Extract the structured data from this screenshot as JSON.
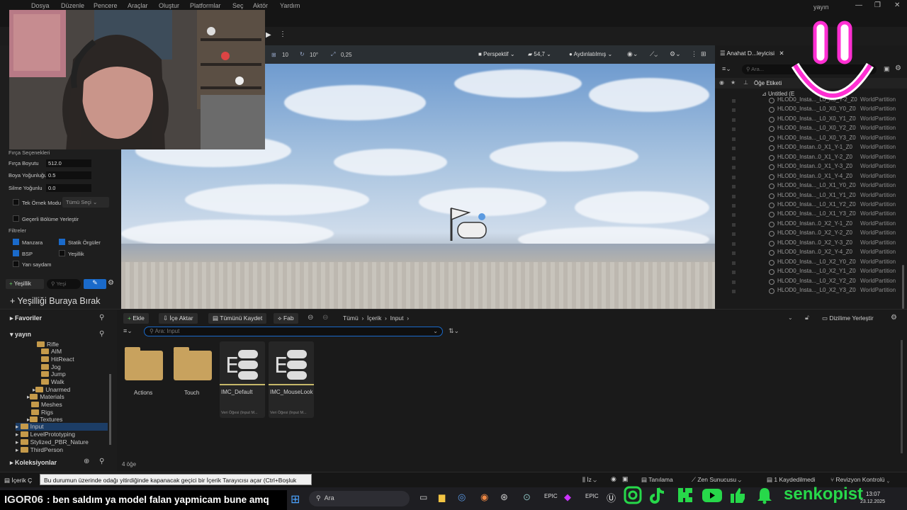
{
  "menu": {
    "items": [
      "Dosya",
      "Düzenle",
      "Pencere",
      "Araçlar",
      "Oluştur",
      "Platformlar",
      "Seç",
      "Aktör",
      "Yardım"
    ],
    "window_title": "yayın"
  },
  "viewport_toolbar": {
    "grid_snap": "10",
    "rot_snap": "10°",
    "scale_snap": "0,25",
    "perspective": "Perspektif",
    "fov": "54,7",
    "lit": "Aydınlatılmış"
  },
  "left_panel": {
    "brush_options_title": "Fırça Seçenekleri",
    "brush_size_label": "Fırça Boyutu",
    "brush_size_value": "512.0",
    "paint_density_label": "Boya Yoğunluğu",
    "paint_density_value": "0.5",
    "erase_density_label": "Silme Yoğunlu",
    "erase_density_value": "0.0",
    "single_sample_label": "Tek Örnek Modu",
    "select_all_label": "Tümü Seçi",
    "place_valid_label": "Geçerli Bölüme Yerleştir",
    "filters_title": "Filtreler",
    "filter_landscape": "Manzara",
    "filter_static_mesh": "Statik Örgüler",
    "filter_bsp": "BSP",
    "filter_foliage": "Yeşillik",
    "filter_translucent": "Yarı saydam",
    "foliage_button": "Yeşillik",
    "search_placeholder": "Yeşi",
    "drop_foliage_text": "+ Yeşilliği Buraya Bırak"
  },
  "outliner": {
    "tab_title": "Anahat D...leyicisi",
    "search_placeholder": "Ara...",
    "column_label": "Öğe Etiketi",
    "root": "Untitled (E",
    "rows": [
      {
        "name": "HLOD0_Insta..._L0_X0_Y-2_Z0",
        "type": "WorldPartition"
      },
      {
        "name": "HLOD0_Insta..._L0_X0_Y0_Z0",
        "type": "WorldPartition"
      },
      {
        "name": "HLOD0_Insta..._L0_X0_Y1_Z0",
        "type": "WorldPartition"
      },
      {
        "name": "HLOD0_Insta..._L0_X0_Y2_Z0",
        "type": "WorldPartition"
      },
      {
        "name": "HLOD0_Insta..._L0_X0_Y3_Z0",
        "type": "WorldPartition"
      },
      {
        "name": "HLOD0_Instan..0_X1_Y-1_Z0",
        "type": "WorldPartition"
      },
      {
        "name": "HLOD0_Instan..0_X1_Y-2_Z0",
        "type": "WorldPartition"
      },
      {
        "name": "HLOD0_Instan..0_X1_Y-3_Z0",
        "type": "WorldPartition"
      },
      {
        "name": "HLOD0_Instan..0_X1_Y-4_Z0",
        "type": "WorldPartition"
      },
      {
        "name": "HLOD0_Insta..._L0_X1_Y0_Z0",
        "type": "WorldPartition"
      },
      {
        "name": "HLOD0_Insta..._L0_X1_Y1_Z0",
        "type": "WorldPartition"
      },
      {
        "name": "HLOD0_Insta..._L0_X1_Y2_Z0",
        "type": "WorldPartition"
      },
      {
        "name": "HLOD0_Insta..._L0_X1_Y3_Z0",
        "type": "WorldPartition"
      },
      {
        "name": "HLOD0_Instan..0_X2_Y-1_Z0",
        "type": "WorldPartition"
      },
      {
        "name": "HLOD0_Instan..0_X2_Y-2_Z0",
        "type": "WorldPartition"
      },
      {
        "name": "HLOD0_Instan..0_X2_Y-3_Z0",
        "type": "WorldPartition"
      },
      {
        "name": "HLOD0_Instan..0_X2_Y-4_Z0",
        "type": "WorldPartition"
      },
      {
        "name": "HLOD0_Insta..._L0_X2_Y0_Z0",
        "type": "WorldPartition"
      },
      {
        "name": "HLOD0_Insta..._L0_X2_Y1_Z0",
        "type": "WorldPartition"
      },
      {
        "name": "HLOD0_Insta..._L0_X2_Y2_Z0",
        "type": "WorldPartition"
      },
      {
        "name": "HLOD0_Insta..._L0_X2_Y3_Z0",
        "type": "WorldPartition"
      }
    ]
  },
  "content_browser": {
    "favorites": "Favoriler",
    "root": "yayın",
    "tree": [
      "Rifle",
      "AIM",
      "HitReact",
      "Jog",
      "Jump",
      "Walk",
      "Unarmed",
      "Materials",
      "Meshes",
      "Rigs",
      "Textures",
      "Input",
      "LevelPrototyping",
      "Stylized_PBR_Nature",
      "ThirdPerson"
    ],
    "collections": "Koleksiyonlar",
    "add_button": "Ekle",
    "import_button": "İçe Aktar",
    "save_all_button": "Tümünü Kaydet",
    "fab_button": "Fab",
    "breadcrumb": [
      "Tümü",
      "İçerik",
      "Input"
    ],
    "dock_button": "Dizilime Yerleştir",
    "search_placeholder": "Ara: Input",
    "items": [
      {
        "name": "Actions",
        "kind": "folder",
        "sub": ""
      },
      {
        "name": "Touch",
        "kind": "folder",
        "sub": ""
      },
      {
        "name": "IMC_Default",
        "kind": "asset",
        "sub": "Veri Öğesi (Input M..."
      },
      {
        "name": "IMC_MouseLook",
        "kind": "asset",
        "sub": "Veri Öğesi (Input M..."
      }
    ],
    "count": "4 öğe"
  },
  "status_bar": {
    "content_drawer": "İçerik Ç",
    "tooltip": "Bu durumun üzerinde odağı yitirdiğinde kapanacak geçici bir İçerik Tarayıcısı açar (Ctrl+Boşluk Çubuğu).",
    "trace": "İz",
    "derived": "Tanılama",
    "zen": "Zen Sunucusu",
    "saved": "1 Kaydedilmedi",
    "revision": "Revizyon Kontrolü"
  },
  "taskbar": {
    "search": "Ara",
    "time": "13:07",
    "date": "23.12.2025"
  },
  "overlay": {
    "chat_user": "IGOR06",
    "chat_text": ": ben saldım ya model falan yapmicam bune amq",
    "brand": "senkopist",
    "colors": {
      "accent": "#ff2fd2",
      "social_green": "#27d84a",
      "chat_user": "#e6e6e6"
    }
  }
}
